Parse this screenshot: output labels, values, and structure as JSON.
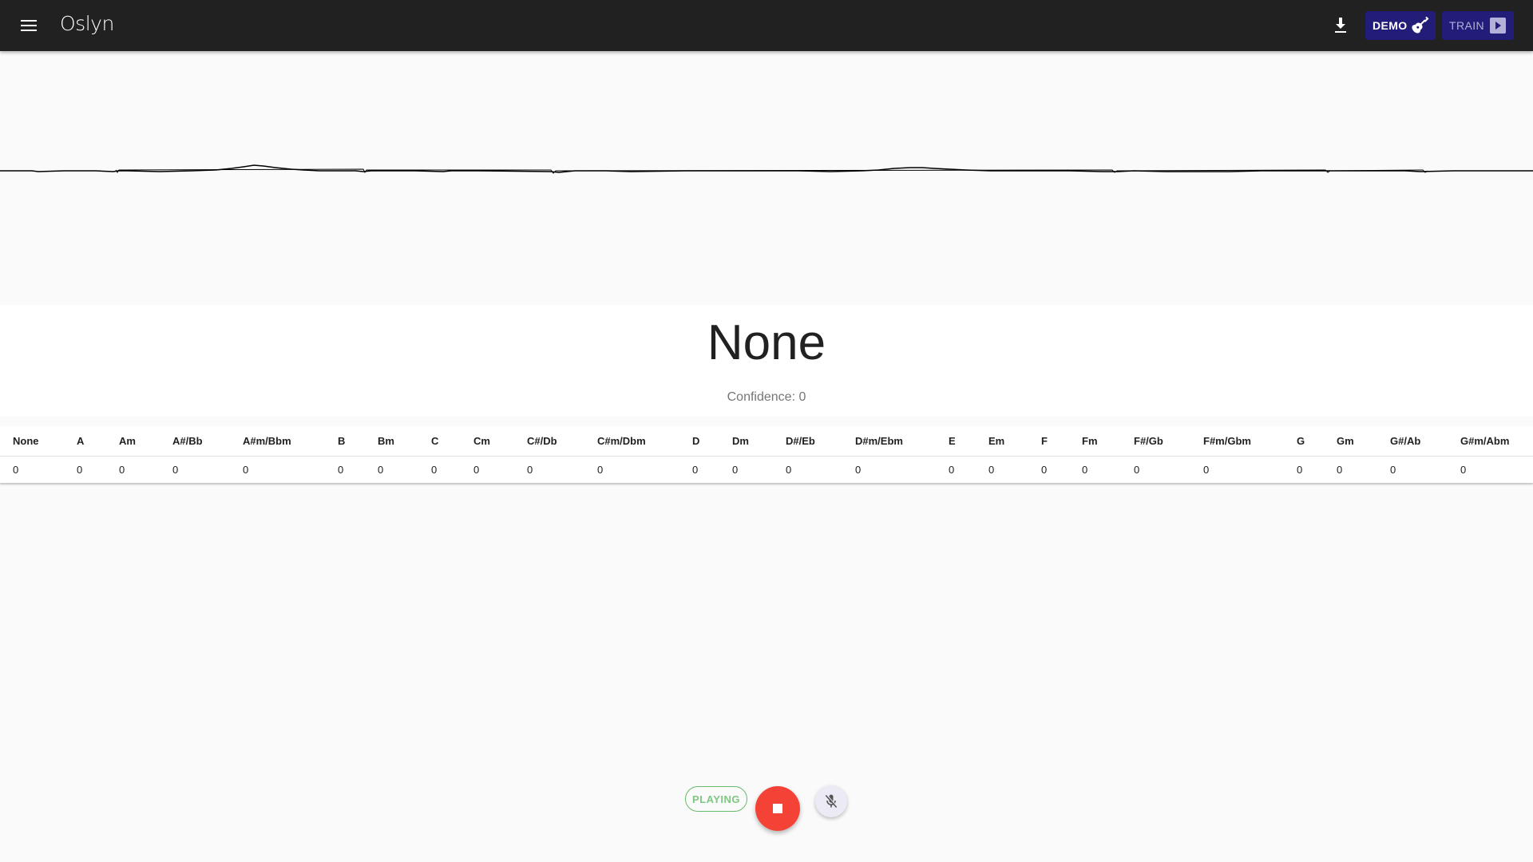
{
  "app": {
    "title": "Oslyn"
  },
  "toolbar": {
    "menu_icon": "menu-icon",
    "download_icon": "download-icon",
    "demo_label": "DEMO",
    "demo_icon": "guitar-icon",
    "train_label": "TRAIN",
    "train_icon": "play-box-icon"
  },
  "colors": {
    "appbar": "#212121",
    "accent": "#231d7a",
    "stop": "#f44336",
    "playing": "#66bb6a"
  },
  "detection": {
    "chord": "None",
    "confidence": "Confidence: 0"
  },
  "table": {
    "headers": [
      "None",
      "A",
      "Am",
      "A#/Bb",
      "A#m/Bbm",
      "B",
      "Bm",
      "C",
      "Cm",
      "C#/Db",
      "C#m/Dbm",
      "D",
      "Dm",
      "D#/Eb",
      "D#m/Ebm",
      "E",
      "Em",
      "F",
      "Fm",
      "F#/Gb",
      "F#m/Gbm",
      "G",
      "Gm",
      "G#/Ab",
      "G#m/Abm"
    ],
    "values": [
      "0",
      "0",
      "0",
      "0",
      "0",
      "0",
      "0",
      "0",
      "0",
      "0",
      "0",
      "0",
      "0",
      "0",
      "0",
      "0",
      "0",
      "0",
      "0",
      "0",
      "0",
      "0",
      "0",
      "0",
      "0"
    ]
  },
  "controls": {
    "status": "PLAYING",
    "stop_icon": "stop-icon",
    "mic_icon": "mic-off-icon"
  }
}
